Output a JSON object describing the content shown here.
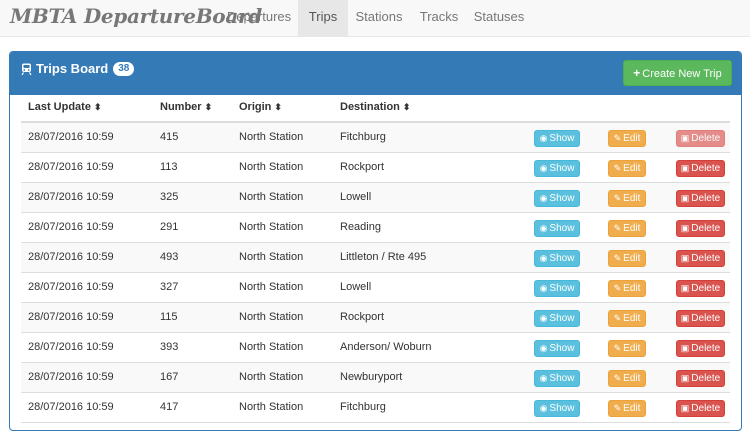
{
  "app": {
    "brand": "MBTA DepartureBoard"
  },
  "nav": [
    {
      "label": "Departures"
    },
    {
      "label": "Trips",
      "active": true
    },
    {
      "label": "Stations"
    },
    {
      "label": "Tracks"
    },
    {
      "label": "Statuses"
    }
  ],
  "panel": {
    "title": "Trips Board",
    "count": "38",
    "create_label": "Create New Trip",
    "heading_color": "#337ab7"
  },
  "table": {
    "columns": [
      "Last Update",
      "Number",
      "Origin",
      "Destination"
    ],
    "actions": {
      "show": "Show",
      "edit": "Edit",
      "delete": "Delete"
    },
    "rows": [
      {
        "updated": "28/07/2016 10:59",
        "number": "415",
        "origin": "North Station",
        "destination": "Fitchburg",
        "delete_disabled": true
      },
      {
        "updated": "28/07/2016 10:59",
        "number": "113",
        "origin": "North Station",
        "destination": "Rockport"
      },
      {
        "updated": "28/07/2016 10:59",
        "number": "325",
        "origin": "North Station",
        "destination": "Lowell"
      },
      {
        "updated": "28/07/2016 10:59",
        "number": "291",
        "origin": "North Station",
        "destination": "Reading"
      },
      {
        "updated": "28/07/2016 10:59",
        "number": "493",
        "origin": "North Station",
        "destination": "Littleton / Rte 495"
      },
      {
        "updated": "28/07/2016 10:59",
        "number": "327",
        "origin": "North Station",
        "destination": "Lowell"
      },
      {
        "updated": "28/07/2016 10:59",
        "number": "115",
        "origin": "North Station",
        "destination": "Rockport"
      },
      {
        "updated": "28/07/2016 10:59",
        "number": "393",
        "origin": "North Station",
        "destination": "Anderson/ Woburn"
      },
      {
        "updated": "28/07/2016 10:59",
        "number": "167",
        "origin": "North Station",
        "destination": "Newburyport"
      },
      {
        "updated": "28/07/2016 10:59",
        "number": "417",
        "origin": "North Station",
        "destination": "Fitchburg"
      }
    ]
  },
  "icons": {
    "train": "train-icon",
    "create": "plus-icon",
    "sort": "sort-icon",
    "show": "eye-icon",
    "edit": "edit-icon",
    "delete": "trash-icon"
  },
  "colors": {
    "primary": "#337ab7",
    "success": "#5cb85c",
    "info": "#5bc0de",
    "warning": "#f0ad4e",
    "danger": "#d9534f"
  }
}
